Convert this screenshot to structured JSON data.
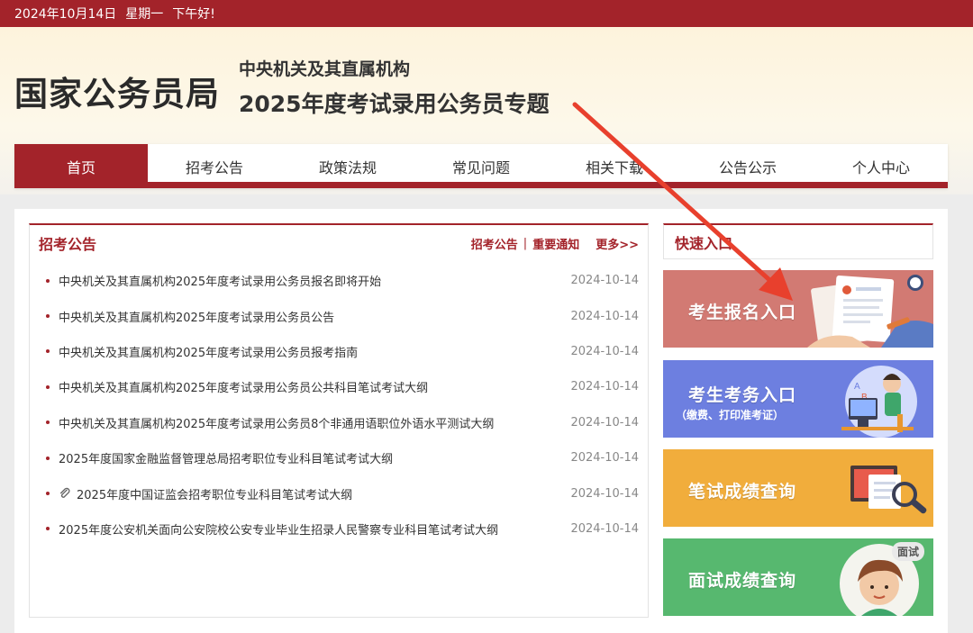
{
  "topbar": {
    "date": "2024年10月14日",
    "weekday": "星期一",
    "greeting": "下午好!"
  },
  "header": {
    "logo": "国家公务员局",
    "subtitle1": "中央机关及其直属机构",
    "subtitle2": "2025年度考试录用公务员专题"
  },
  "nav": [
    "首页",
    "招考公告",
    "政策法规",
    "常见问题",
    "相关下载",
    "公告公示",
    "个人中心"
  ],
  "news": {
    "title": "招考公告",
    "link1": "招考公告",
    "link2": "重要通知",
    "more": "更多>>",
    "items": [
      {
        "title": "中央机关及其直属机构2025年度考试录用公务员报名即将开始",
        "date": "2024-10-14"
      },
      {
        "title": "中央机关及其直属机构2025年度考试录用公务员公告",
        "date": "2024-10-14"
      },
      {
        "title": "中央机关及其直属机构2025年度考试录用公务员报考指南",
        "date": "2024-10-14"
      },
      {
        "title": "中央机关及其直属机构2025年度考试录用公务员公共科目笔试考试大纲",
        "date": "2024-10-14"
      },
      {
        "title": "中央机关及其直属机构2025年度考试录用公务员8个非通用语职位外语水平测试大纲",
        "date": "2024-10-14"
      },
      {
        "title": "2025年度国家金融监督管理总局招考职位专业科目笔试考试大纲",
        "date": "2024-10-14"
      },
      {
        "title": "2025年度中国证监会招考职位专业科目笔试考试大纲",
        "date": "2024-10-14"
      },
      {
        "title": "2025年度公安机关面向公安院校公安专业毕业生招录人民警察专业科目笔试考试大纲",
        "date": "2024-10-14"
      }
    ]
  },
  "quick": {
    "title": "快速入口",
    "cards": [
      {
        "label": "考生报名入口",
        "color": "#d27a73"
      },
      {
        "label": "考生考务入口",
        "sub": "（缴费、打印准考证）",
        "color": "#6d7fe0"
      },
      {
        "label": "笔试成绩查询",
        "color": "#f1ad3c"
      },
      {
        "label": "面试成绩查询",
        "badge": "面试",
        "color": "#57b86f"
      }
    ]
  },
  "annotation": {
    "color": "#e8402d"
  }
}
